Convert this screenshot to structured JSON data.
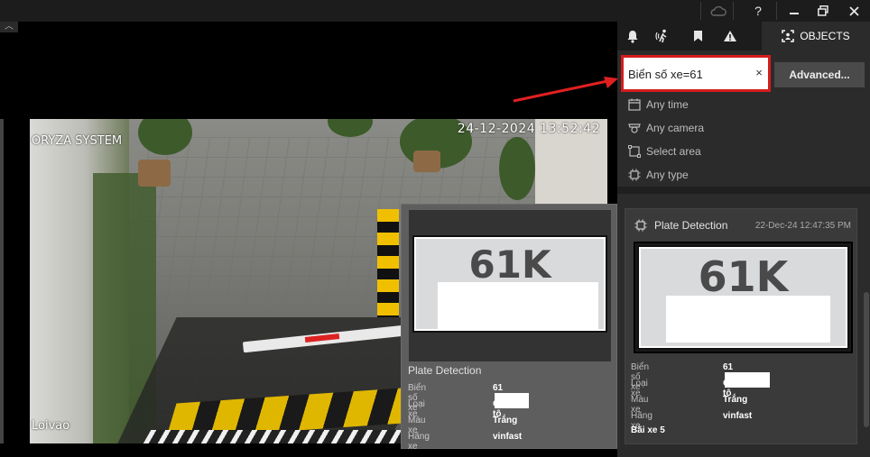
{
  "titlebar": {
    "cloud_icon": "cloud-icon",
    "help_label": "?",
    "minimize_icon": "minimize-icon",
    "restore_icon": "restore-icon",
    "close_icon": "close-icon"
  },
  "collapse_label": "︿",
  "video": {
    "brand": "ORYZA SYSTEM",
    "timestamp": "24-12-2024 13:52:42",
    "camera_name": "Loivao"
  },
  "panel": {
    "tabs": [
      {
        "icon": "bell-icon"
      },
      {
        "icon": "motion-icon"
      },
      {
        "icon": "bookmark-icon"
      },
      {
        "icon": "warning-icon"
      }
    ],
    "objects_tab_label": "OBJECTS",
    "search_value": "Biển số xe=61",
    "clear_label": "×",
    "advanced_label": "Advanced...",
    "filters": [
      {
        "label": "Any time",
        "icon": "calendar-icon"
      },
      {
        "label": "Any camera",
        "icon": "camera-icon"
      },
      {
        "label": "Select area",
        "icon": "area-icon"
      },
      {
        "label": "Any type",
        "icon": "chip-icon"
      }
    ]
  },
  "popup": {
    "plate_text": "61K",
    "title": "Plate Detection",
    "props": [
      {
        "key": "Biển số xe",
        "value": "61"
      },
      {
        "key": "Loại xe",
        "value": "Ô tô"
      },
      {
        "key": "Màu xe",
        "value": "Trắng"
      },
      {
        "key": "Hãng xe",
        "value": "vinfast"
      }
    ]
  },
  "card": {
    "title": "Plate Detection",
    "timestamp": "22-Dec-24 12:47:35 PM",
    "plate_text": "61K",
    "props": [
      {
        "key": "Biển số xe",
        "value": "61"
      },
      {
        "key": "Loại xe",
        "value": "Ô tô"
      },
      {
        "key": "Màu xe",
        "value": "Trắng"
      },
      {
        "key": "Hãng xe",
        "value": "vinfast"
      }
    ],
    "footer": "Bãi xe 5"
  },
  "colors": {
    "highlight": "#d41c1c",
    "panel_bg": "#2b2b2b",
    "titlebar_bg": "#1c1c1c"
  }
}
